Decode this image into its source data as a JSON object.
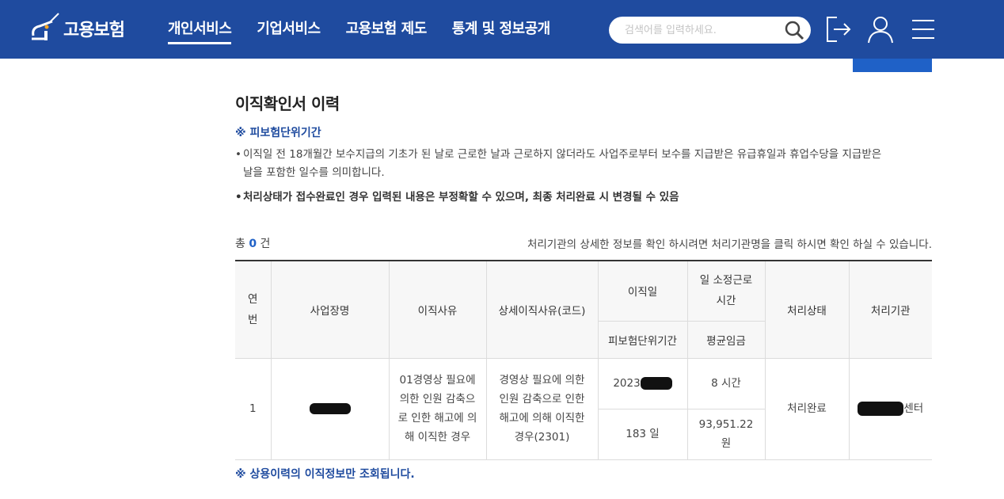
{
  "header": {
    "logo_text": "고용보험",
    "nav": [
      {
        "label": "개인서비스"
      },
      {
        "label": "기업서비스"
      },
      {
        "label": "고용보험 제도"
      },
      {
        "label": "통계 및 정보공개"
      }
    ],
    "active_nav": 0,
    "search_placeholder": "검색어를 입력하세요.",
    "icons": [
      "search-icon",
      "logout-icon",
      "user-icon",
      "menu-icon"
    ],
    "colors": {
      "header_bg": "#1f4b9f",
      "accent": "#1f61c7"
    }
  },
  "page": {
    "title": "이직확인서 이력",
    "note_heading": "※ 피보험단위기간",
    "bullet1_line1": "이직일 전 18개월간 보수지급의 기초가 된 날로 근로한 날과 근로하지 않더라도 사업주로부터 보수를 지급받은 유급휴일과 휴업수당을 지급받은",
    "bullet1_line2": "날을 포함한 일수를 의미합니다.",
    "bullet2": "처리상태가 접수완료인 경우 입력된 내용은 부정확할 수 있으며, 최종 처리완료 시 변경될 수 있음",
    "bullet_mark": "•",
    "count_prefix": "총",
    "count_value": "0",
    "count_suffix": "건",
    "hint": "처리기관의 상세한 정보를 확인 하시려면 처리기관명을 클릭 하시면 확인 하실 수 있습니다.",
    "footnote": "※ 상용이력의 이직정보만 조회됩니다."
  },
  "table": {
    "headers": {
      "no": "연번",
      "company": "사업장명",
      "reason": "이직사유",
      "detail_reason": "상세이직사유(코드)",
      "leave_date": "이직일",
      "hours": "일 소정근로시간",
      "status": "처리상태",
      "agency": "처리기관",
      "insured_period": "피보험단위기간",
      "avg_wage": "평균임금"
    },
    "rows": [
      {
        "no": "1",
        "reason": "01경영상 필요에 의한 인원 감축으로 인한 해고에 의해 이직한 경우",
        "detail_reason": "경영상 필요에 의한 인원 감축으로 인한 해고에 의해 이직한 경우(2301)",
        "leave_date_visible": "2023",
        "hours": "8 시간",
        "insured_period": "183 일",
        "avg_wage": "93,951.22 원",
        "status": "처리완료",
        "agency_visible": "센터"
      }
    ]
  }
}
